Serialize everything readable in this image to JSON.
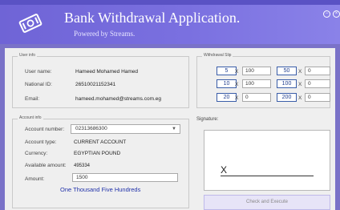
{
  "app": {
    "title": "Bank Withdrawal Application.",
    "subtitle": "Powered by Streams."
  },
  "user_info": {
    "legend": "User info",
    "fields": [
      {
        "label": "User name:",
        "value": "Hameed Mohamed Hamed"
      },
      {
        "label": "National ID:",
        "value": "26510021152341"
      },
      {
        "label": "Email:",
        "value": "hameed.mohamed@streams.com.eg"
      }
    ]
  },
  "account_info": {
    "legend": "Account info",
    "account_number_label": "Account number:",
    "account_number": "02313686300",
    "account_type_label": "Account type:",
    "account_type": "CURRENT ACCOUNT",
    "currency_label": "Currency:",
    "currency": "EGYPTIAN POUND",
    "available_label": "Available amount:",
    "available": "495334",
    "amount_label": "Amount:",
    "amount": "1500",
    "amount_words": "One Thousand Five Hundreds"
  },
  "withdrawal_slip": {
    "legend": "Withdrawal Slip",
    "times": "X",
    "rows": [
      {
        "denom": "5",
        "count": "100",
        "denom2": "50",
        "count2": "0"
      },
      {
        "denom": "10",
        "count": "100",
        "denom2": "100",
        "count2": "0"
      },
      {
        "denom": "20",
        "count": "0",
        "denom2": "200",
        "count2": "0"
      }
    ]
  },
  "signature": {
    "label": "Signature:",
    "mark": "X"
  },
  "actions": {
    "check_label": "Check and Execute"
  }
}
